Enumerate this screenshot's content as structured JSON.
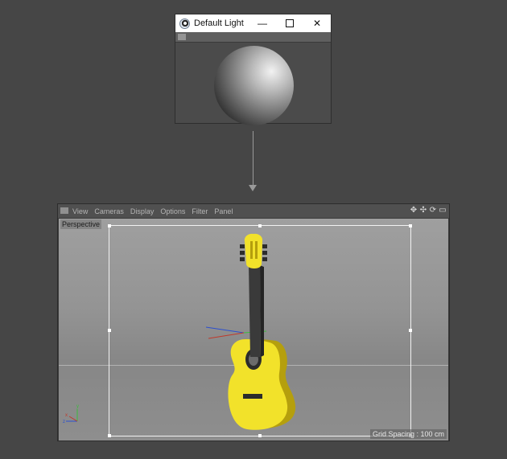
{
  "light_window": {
    "title": "Default Light",
    "icon": "cinema4d-app-icon",
    "controls": {
      "minimize": "—",
      "maximize": "maximize-icon",
      "close": "✕"
    }
  },
  "viewport": {
    "menu": [
      "View",
      "Cameras",
      "Display",
      "Options",
      "Filter",
      "Panel"
    ],
    "nav_icons": [
      "move-icon",
      "zoom-icon",
      "rotate-icon",
      "panel-toggle-icon"
    ],
    "nav_glyphs": [
      "✥",
      "✣",
      "⟳",
      "▭"
    ],
    "camera_label": "Perspective",
    "grid_label": "Grid Spacing : 100 cm"
  },
  "colors": {
    "guitar_body": "#f2e22a",
    "guitar_edge": "#b59f0d",
    "guitar_neck": "#3a3a3a",
    "axis_x": "#c0392b",
    "axis_y": "#3dbb3d",
    "axis_z": "#2b4fcf"
  }
}
